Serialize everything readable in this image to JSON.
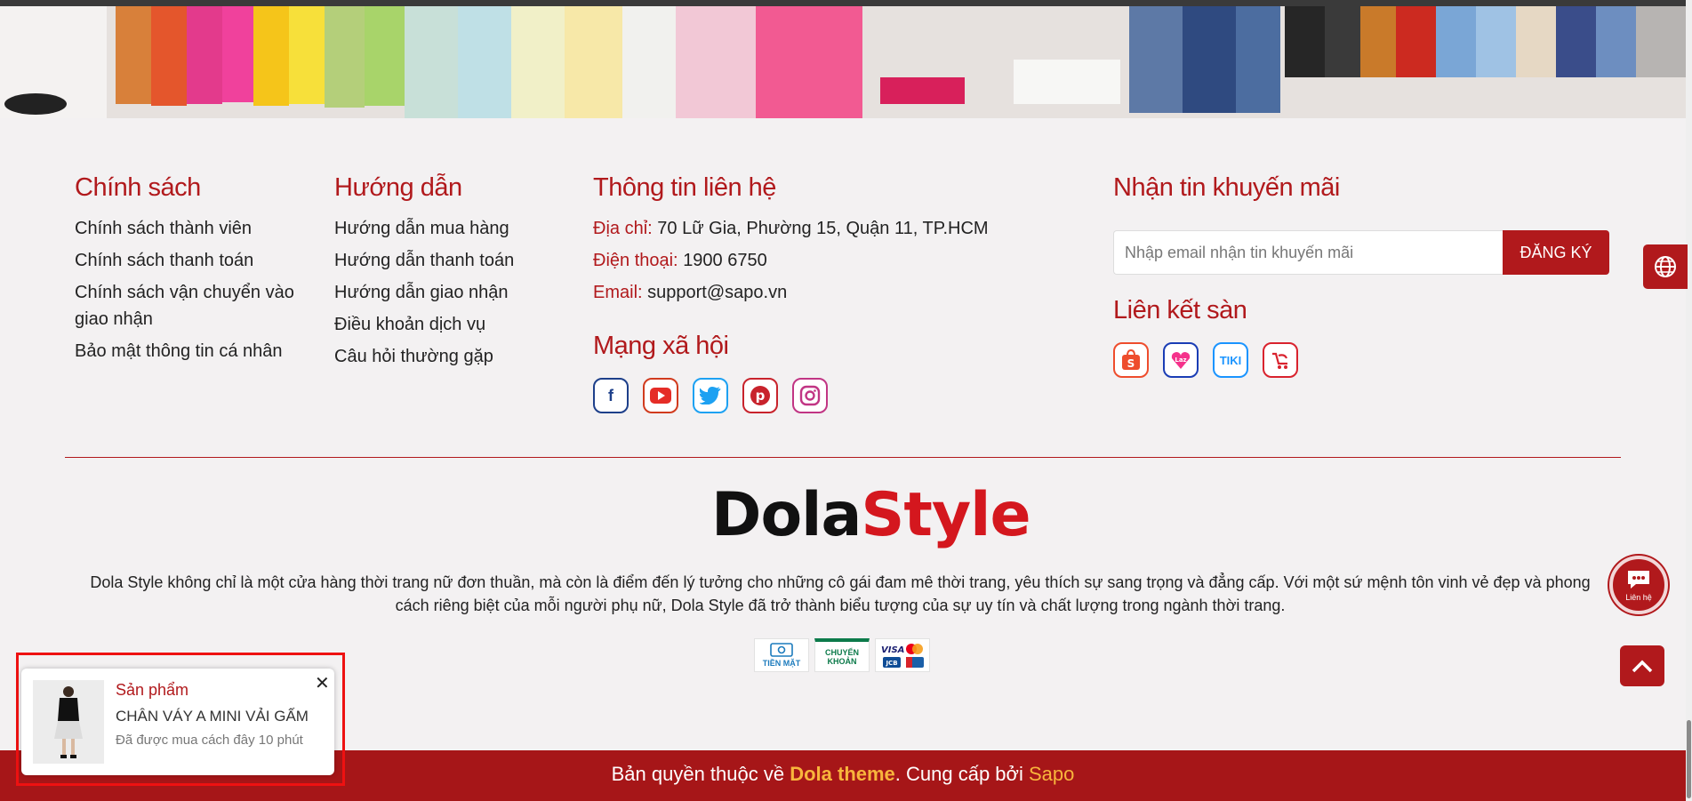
{
  "footer": {
    "policy": {
      "title": "Chính sách",
      "items": [
        "Chính sách thành viên",
        "Chính sách thanh toán",
        "Chính sách vận chuyển vào giao nhận",
        "Bảo mật thông tin cá nhân"
      ]
    },
    "guide": {
      "title": "Hướng dẫn",
      "items": [
        "Hướng dẫn mua hàng",
        "Hướng dẫn thanh toán",
        "Hướng dẫn giao nhận",
        "Điều khoản dịch vụ",
        "Câu hỏi thường gặp"
      ]
    },
    "contact": {
      "title": "Thông tin liên hệ",
      "address_label": "Địa chỉ:",
      "address": "70 Lữ Gia, Phường 15, Quận 11, TP.HCM",
      "phone_label": "Điện thoại:",
      "phone": "1900 6750",
      "email_label": "Email:",
      "email": "support@sapo.vn"
    },
    "social": {
      "title": "Mạng xã hội",
      "icons": [
        "facebook-icon",
        "youtube-icon",
        "twitter-icon",
        "pinterest-icon",
        "instagram-icon"
      ]
    },
    "newsletter": {
      "title": "Nhận tin khuyến mãi",
      "placeholder": "Nhập email nhận tin khuyến mãi",
      "button": "ĐĂNG KÝ"
    },
    "marketplaces": {
      "title": "Liên kết sàn",
      "icons": [
        "shopee-icon",
        "lazada-icon",
        "tiki-icon",
        "sendo-icon"
      ]
    },
    "brand": {
      "part1": "Dola",
      "part2": "Style"
    },
    "about": "Dola Style không chỉ là một cửa hàng thời trang nữ đơn thuần, mà còn là điểm đến lý tưởng cho những cô gái đam mê thời trang, yêu thích sự sang trọng và đẳng cấp. Với một sứ mệnh tôn vinh vẻ đẹp và phong cách riêng biệt của mỗi người phụ nữ, Dola Style đã trở thành biểu tượng của sự uy tín và chất lượng trong ngành thời trang.",
    "payments": {
      "cash": "TIỀN MẶT",
      "transfer": "CHUYỂN KHOẢN",
      "visa": "VISA",
      "jcb": "JCB"
    },
    "copyright": {
      "prefix": "Bản quyền thuộc về ",
      "theme": "Dola theme",
      "middle": ". Cung cấp bởi ",
      "provider": "Sapo"
    }
  },
  "widgets": {
    "chat_label": "Liên hệ"
  },
  "toast": {
    "label": "Sản phẩm",
    "product": "CHÂN VÁY A MINI VẢI GẤM",
    "time": "Đã được mua cách đây 10 phút"
  },
  "colors": {
    "accent": "#b1191c",
    "brand_red": "#d4171e",
    "highlight": "#f8b53c"
  }
}
